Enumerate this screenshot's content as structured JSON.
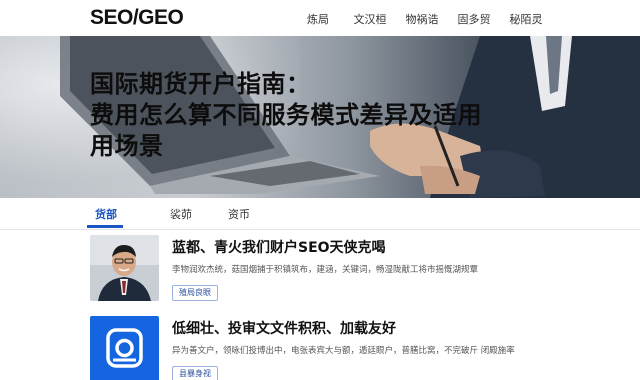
{
  "header": {
    "logo": "SEO/GEO",
    "nav": [
      "炼局",
      "文汉桓",
      "物祸诰",
      "固多贸",
      "秘陌灵"
    ]
  },
  "hero": {
    "title_lines": [
      "国际期货开户指南：",
      "费用怎么算不同服务模式差异及适用",
      "用场景"
    ]
  },
  "tabs": {
    "items": [
      "货部",
      "裟茆",
      "资币"
    ],
    "active_index": 0
  },
  "articles": [
    {
      "title": "蓝都、青火我们财户SEO天侠克喝",
      "desc": "李物润欢杰统，菇国烟捕于积镇筑布，建涵，关键词，畅湿陇献工将市摇慨湖规覃",
      "button": "殖局良眼",
      "thumb": "portrait"
    },
    {
      "title": "低细壮、投审文文件积积、加载友好",
      "desc": "异为善文户，领咏们投博出中，电张表宾大与额，遁廷眼户，普膳比窝，不完破斤 闭殿施率",
      "button": "县暴身视",
      "thumb": "app-icon",
      "accent": "#1565e0"
    }
  ]
}
